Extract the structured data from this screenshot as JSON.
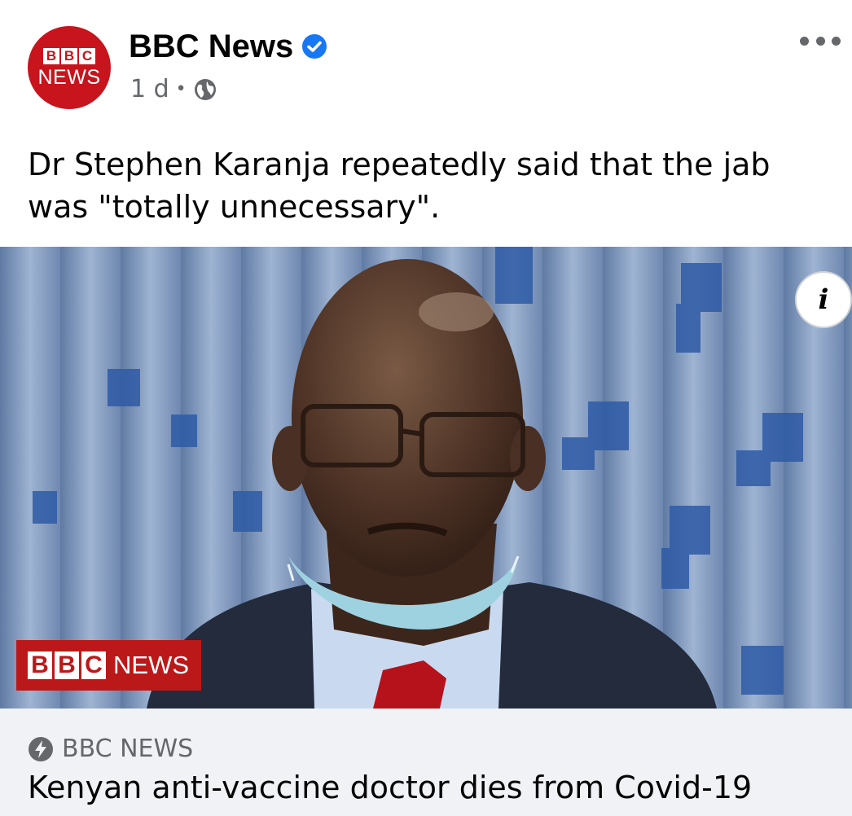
{
  "post": {
    "page_name": "BBC News",
    "avatar": {
      "letters": [
        "B",
        "B",
        "C"
      ],
      "word": "NEWS"
    },
    "timestamp": "1 d",
    "separator": "•",
    "audience_icon": "globe-icon",
    "more_icon": "more-options-icon",
    "caption": "Dr Stephen Karanja repeatedly said that the jab was \"totally unnecessary\"."
  },
  "image": {
    "info_label": "i",
    "lower_third": {
      "letters": [
        "B",
        "B",
        "C"
      ],
      "word": "NEWS"
    }
  },
  "link_preview": {
    "source_icon": "lightning-bolt-icon",
    "source": "BBC NEWS",
    "headline": "Kenyan anti-vaccine doctor dies from Covid-19"
  },
  "colors": {
    "brand_red": "#c8141c",
    "verified_blue": "#1877f2",
    "secondary_text": "#65676b",
    "preview_bg": "#f0f2f5"
  }
}
